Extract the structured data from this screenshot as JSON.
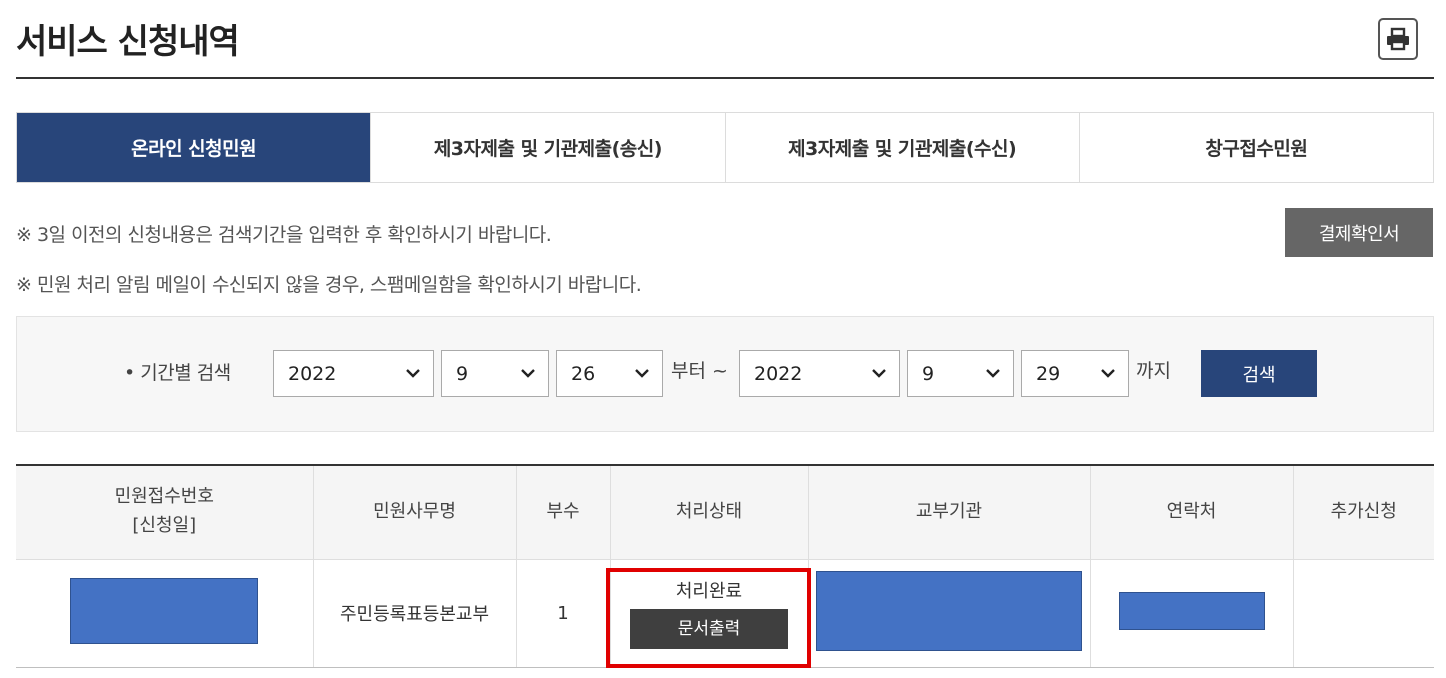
{
  "header": {
    "title": "서비스 신청내역",
    "print_icon": "printer-icon"
  },
  "tabs": [
    {
      "label": "온라인 신청민원",
      "active": true
    },
    {
      "label": "제3자제출 및 기관제출(송신)",
      "active": false
    },
    {
      "label": "제3자제출 및 기관제출(수신)",
      "active": false
    },
    {
      "label": "창구접수민원",
      "active": false
    }
  ],
  "notices": [
    "※ 3일 이전의 신청내용은 검색기간을 입력한 후 확인하시기 바랍니다.",
    "※ 민원 처리 알림 메일이 수신되지 않을 경우, 스팸메일함을 확인하시기 바랍니다."
  ],
  "confirm_button": "결제확인서",
  "search": {
    "label": "• 기간별 검색",
    "from": {
      "year": "2022",
      "month": "9",
      "day": "26"
    },
    "from_suffix": "부터 ~",
    "to": {
      "year": "2022",
      "month": "9",
      "day": "29"
    },
    "to_suffix": "까지",
    "button": "검색"
  },
  "table": {
    "headers": {
      "receipt_no": "민원접수번호",
      "receipt_date": "[신청일]",
      "service_name": "민원사무명",
      "copies": "부수",
      "status": "처리상태",
      "issuer": "교부기관",
      "contact": "연락처",
      "additional": "추가신청"
    },
    "rows": [
      {
        "service_name": "주민등록표등본교부",
        "copies": "1",
        "status": "처리완료",
        "print_button": "문서출력"
      }
    ]
  },
  "colors": {
    "primary": "#28457a",
    "redaction": "#4472c4",
    "highlight": "#e00000"
  }
}
